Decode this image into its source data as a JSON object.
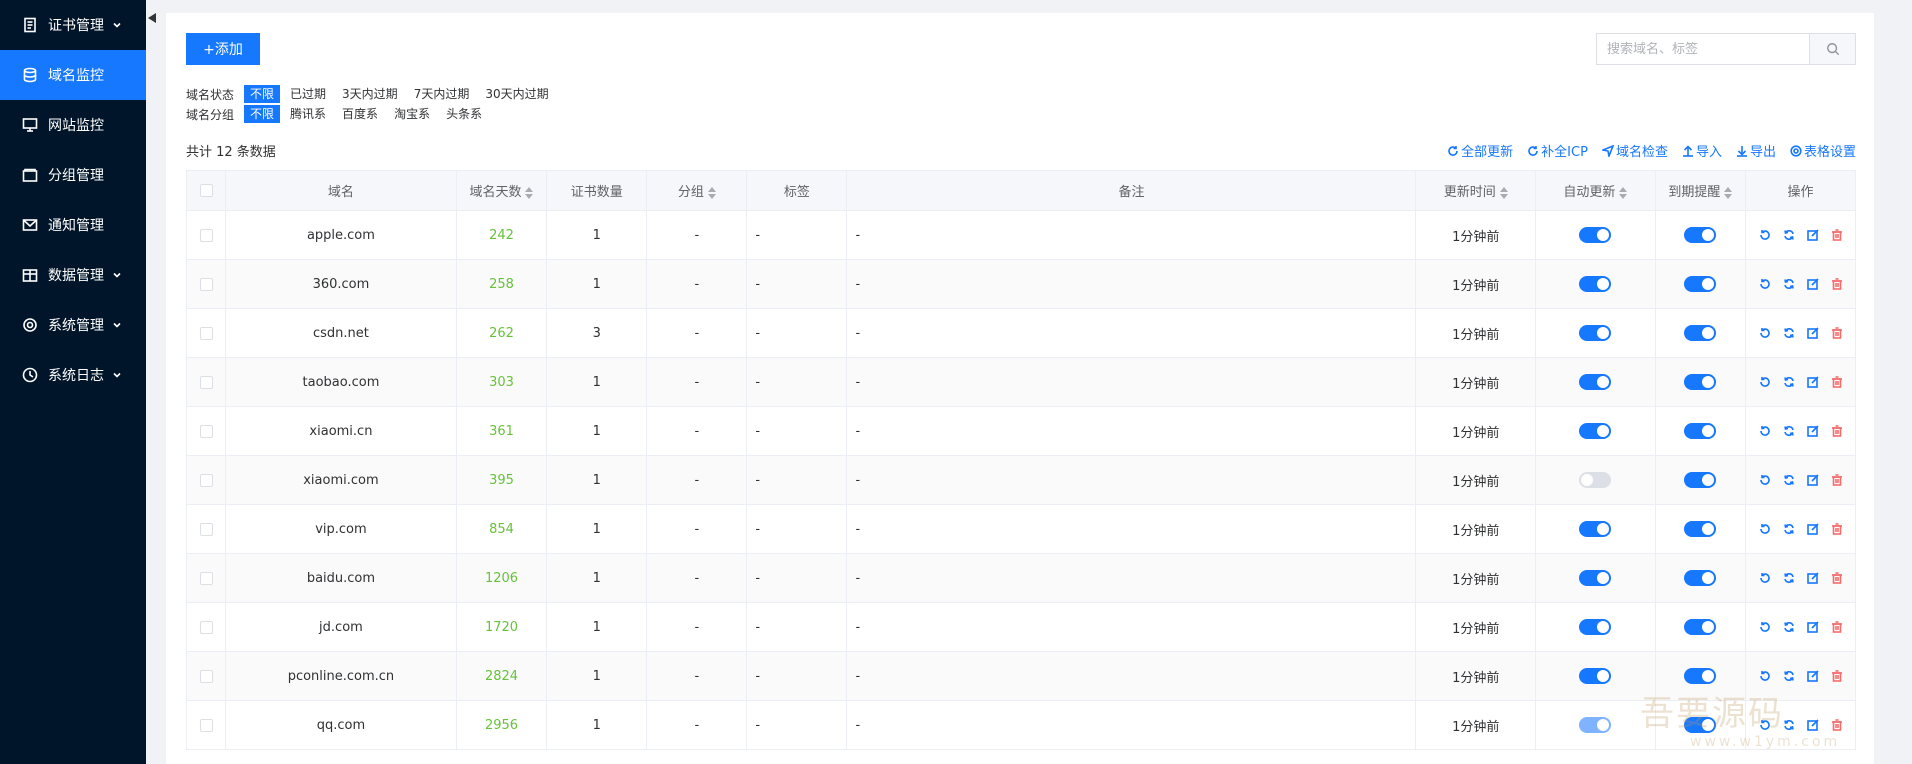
{
  "sidebar": {
    "items": [
      {
        "label": "证书管理",
        "icon": "document-icon",
        "has_caret": true,
        "active": false
      },
      {
        "label": "域名监控",
        "icon": "database-icon",
        "has_caret": false,
        "active": true
      },
      {
        "label": "网站监控",
        "icon": "monitor-icon",
        "has_caret": false,
        "active": false
      },
      {
        "label": "分组管理",
        "icon": "folder-icon",
        "has_caret": false,
        "active": false
      },
      {
        "label": "通知管理",
        "icon": "mail-icon",
        "has_caret": false,
        "active": false
      },
      {
        "label": "数据管理",
        "icon": "box-icon",
        "has_caret": true,
        "active": false
      },
      {
        "label": "系统管理",
        "icon": "gear-icon",
        "has_caret": true,
        "active": false
      },
      {
        "label": "系统日志",
        "icon": "clock-icon",
        "has_caret": true,
        "active": false
      }
    ]
  },
  "actions": {
    "add_label": "+添加"
  },
  "search": {
    "placeholder": "搜索域名、标签"
  },
  "filters": {
    "status": {
      "label": "域名状态",
      "options": [
        "不限",
        "已过期",
        "3天内过期",
        "7天内过期",
        "30天内过期"
      ],
      "selected": "不限"
    },
    "group": {
      "label": "域名分组",
      "options": [
        "不限",
        "腾讯系",
        "百度系",
        "淘宝系",
        "头条系"
      ],
      "selected": "不限"
    }
  },
  "summary": {
    "total_text": "共计 12 条数据"
  },
  "toolbar": {
    "refresh_all": "全部更新",
    "fill_icp": "补全ICP",
    "check_domain": "域名检查",
    "import": "导入",
    "export": "导出",
    "table_settings": "表格设置"
  },
  "table": {
    "headers": {
      "domain": "域名",
      "days": "域名天数",
      "cert_count": "证书数量",
      "group": "分组",
      "tags": "标签",
      "remark": "备注",
      "updated": "更新时间",
      "auto_update": "自动更新",
      "expire_alert": "到期提醒",
      "ops": "操作"
    },
    "rows": [
      {
        "domain": "apple.com",
        "days": "242",
        "certs": "1",
        "group": "-",
        "tags": "-",
        "remark": "-",
        "updated": "1分钟前",
        "auto_update": true,
        "alert": true
      },
      {
        "domain": "360.com",
        "days": "258",
        "certs": "1",
        "group": "-",
        "tags": "-",
        "remark": "-",
        "updated": "1分钟前",
        "auto_update": true,
        "alert": true
      },
      {
        "domain": "csdn.net",
        "days": "262",
        "certs": "3",
        "group": "-",
        "tags": "-",
        "remark": "-",
        "updated": "1分钟前",
        "auto_update": true,
        "alert": true
      },
      {
        "domain": "taobao.com",
        "days": "303",
        "certs": "1",
        "group": "-",
        "tags": "-",
        "remark": "-",
        "updated": "1分钟前",
        "auto_update": true,
        "alert": true
      },
      {
        "domain": "xiaomi.cn",
        "days": "361",
        "certs": "1",
        "group": "-",
        "tags": "-",
        "remark": "-",
        "updated": "1分钟前",
        "auto_update": true,
        "alert": true
      },
      {
        "domain": "xiaomi.com",
        "days": "395",
        "certs": "1",
        "group": "-",
        "tags": "-",
        "remark": "-",
        "updated": "1分钟前",
        "auto_update": false,
        "alert": true
      },
      {
        "domain": "vip.com",
        "days": "854",
        "certs": "1",
        "group": "-",
        "tags": "-",
        "remark": "-",
        "updated": "1分钟前",
        "auto_update": true,
        "alert": true
      },
      {
        "domain": "baidu.com",
        "days": "1206",
        "certs": "1",
        "group": "-",
        "tags": "-",
        "remark": "-",
        "updated": "1分钟前",
        "auto_update": true,
        "alert": true
      },
      {
        "domain": "jd.com",
        "days": "1720",
        "certs": "1",
        "group": "-",
        "tags": "-",
        "remark": "-",
        "updated": "1分钟前",
        "auto_update": true,
        "alert": true
      },
      {
        "domain": "pconline.com.cn",
        "days": "2824",
        "certs": "1",
        "group": "-",
        "tags": "-",
        "remark": "-",
        "updated": "1分钟前",
        "auto_update": true,
        "alert": true
      },
      {
        "domain": "qq.com",
        "days": "2956",
        "certs": "1",
        "group": "-",
        "tags": "-",
        "remark": "-",
        "updated": "1分钟前",
        "auto_update": true,
        "alert": true
      }
    ]
  },
  "watermark": {
    "text": "吾要源码",
    "sub": "www.w1ym.com"
  },
  "colors": {
    "sidebar_bg": "#001529",
    "accent": "#1677ff",
    "days_green": "#67c23a",
    "delete_red": "#f56c6c"
  }
}
